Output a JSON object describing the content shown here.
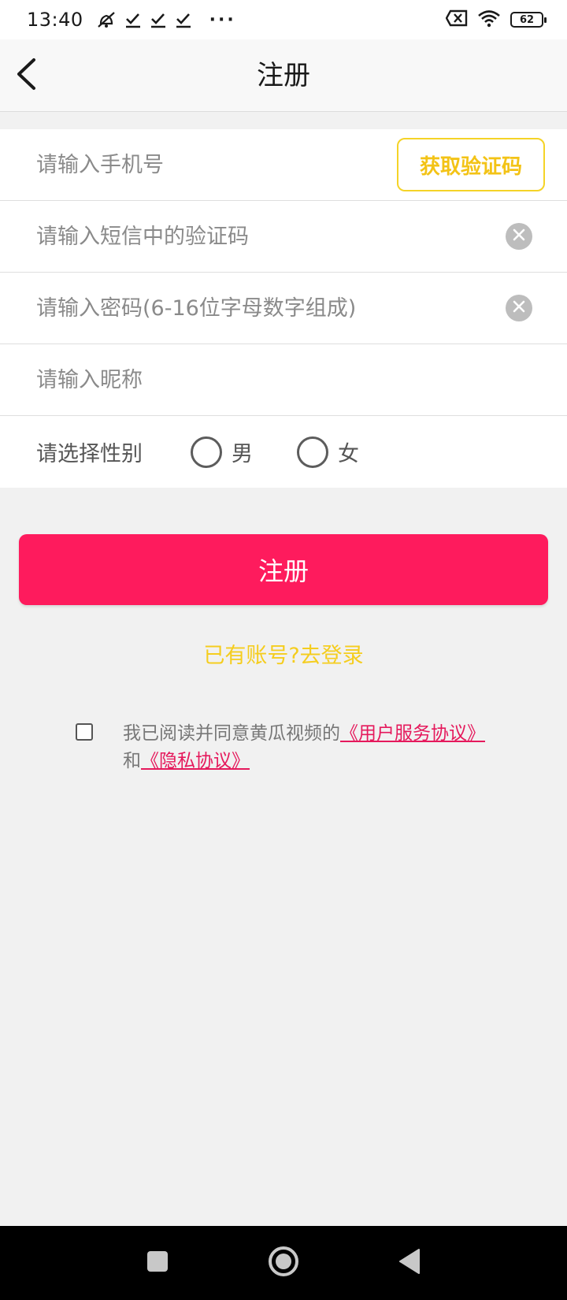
{
  "status_bar": {
    "time": "13:40",
    "left_icons": [
      "mute-bell-icon",
      "download-done-icon",
      "download-done-icon",
      "download-done-icon"
    ],
    "more": "···",
    "right_icons": [
      "sim-off-icon",
      "wifi-icon",
      "battery-icon"
    ],
    "battery_level": "62"
  },
  "nav": {
    "title": "注册",
    "back_icon": "chevron-left-icon"
  },
  "form": {
    "phone_placeholder": "请输入手机号",
    "get_code_label": "获取验证码",
    "sms_code_placeholder": "请输入短信中的验证码",
    "password_placeholder": "请输入密码(6-16位字母数字组成)",
    "nickname_placeholder": "请输入昵称",
    "gender_label": "请选择性别",
    "gender_male": "男",
    "gender_female": "女"
  },
  "register_button": "注册",
  "login_link": "已有账号?去登录",
  "agreement": {
    "prefix": "我已阅读并同意黄瓜视频的",
    "user_agreement": "《用户服务协议》",
    "and": "和",
    "privacy_agreement": "《隐私协议》"
  },
  "system_nav": {
    "icons": [
      "recent-apps-icon",
      "home-icon",
      "back-icon"
    ]
  },
  "colors": {
    "accent_pink": "#fe1b5d",
    "accent_yellow": "#f5cd1e",
    "link_pink": "#e5195c"
  }
}
